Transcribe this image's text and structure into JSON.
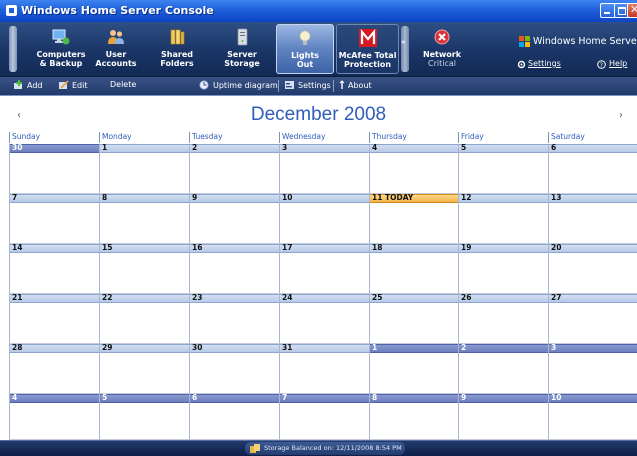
{
  "window": {
    "title": "Windows Home Server Console"
  },
  "nav": {
    "tabs": [
      {
        "line1": "Computers",
        "line2": "& Backup"
      },
      {
        "line1": "User",
        "line2": "Accounts"
      },
      {
        "line1": "Shared",
        "line2": "Folders"
      },
      {
        "line1": "Server",
        "line2": "Storage"
      },
      {
        "line1": "Lights",
        "line2": "Out"
      },
      {
        "line1": "McAfee Total",
        "line2": "Protection"
      },
      {
        "line1": "Network",
        "line2": "Critical"
      }
    ],
    "more_glyph": "»",
    "brand": "Windows Home Server",
    "settings_label": "Settings",
    "help_label": "Help"
  },
  "toolbar": {
    "add_label": "Add",
    "edit_label": "Edit",
    "delete_label": "Delete",
    "uptime_label": "Uptime diagram",
    "settings_label": "Settings",
    "about_label": "About"
  },
  "calendar": {
    "title": "December 2008",
    "prev_glyph": "‹",
    "next_glyph": "›",
    "weekdays": [
      "Sunday",
      "Monday",
      "Tuesday",
      "Wednesday",
      "Thursday",
      "Friday",
      "Saturday"
    ],
    "weeks": [
      [
        "30",
        "1",
        "2",
        "3",
        "4",
        "5",
        "6"
      ],
      [
        "7",
        "8",
        "9",
        "10",
        "11 TODAY",
        "12",
        "13"
      ],
      [
        "14",
        "15",
        "16",
        "17",
        "18",
        "19",
        "20"
      ],
      [
        "21",
        "22",
        "23",
        "24",
        "25",
        "26",
        "27"
      ],
      [
        "28",
        "29",
        "30",
        "31",
        "1",
        "2",
        "3"
      ],
      [
        "4",
        "5",
        "6",
        "7",
        "8",
        "9",
        "10"
      ]
    ]
  },
  "status": {
    "text": "Storage Balanced on: 12/11/2008 8:54 PM"
  },
  "colors": {
    "accent": "#2f5db9",
    "today_header": "#f4b24a",
    "other_month_header": "#6d7fc0",
    "network_critical": "#d9333a",
    "mcafee_red": "#d71a21"
  }
}
